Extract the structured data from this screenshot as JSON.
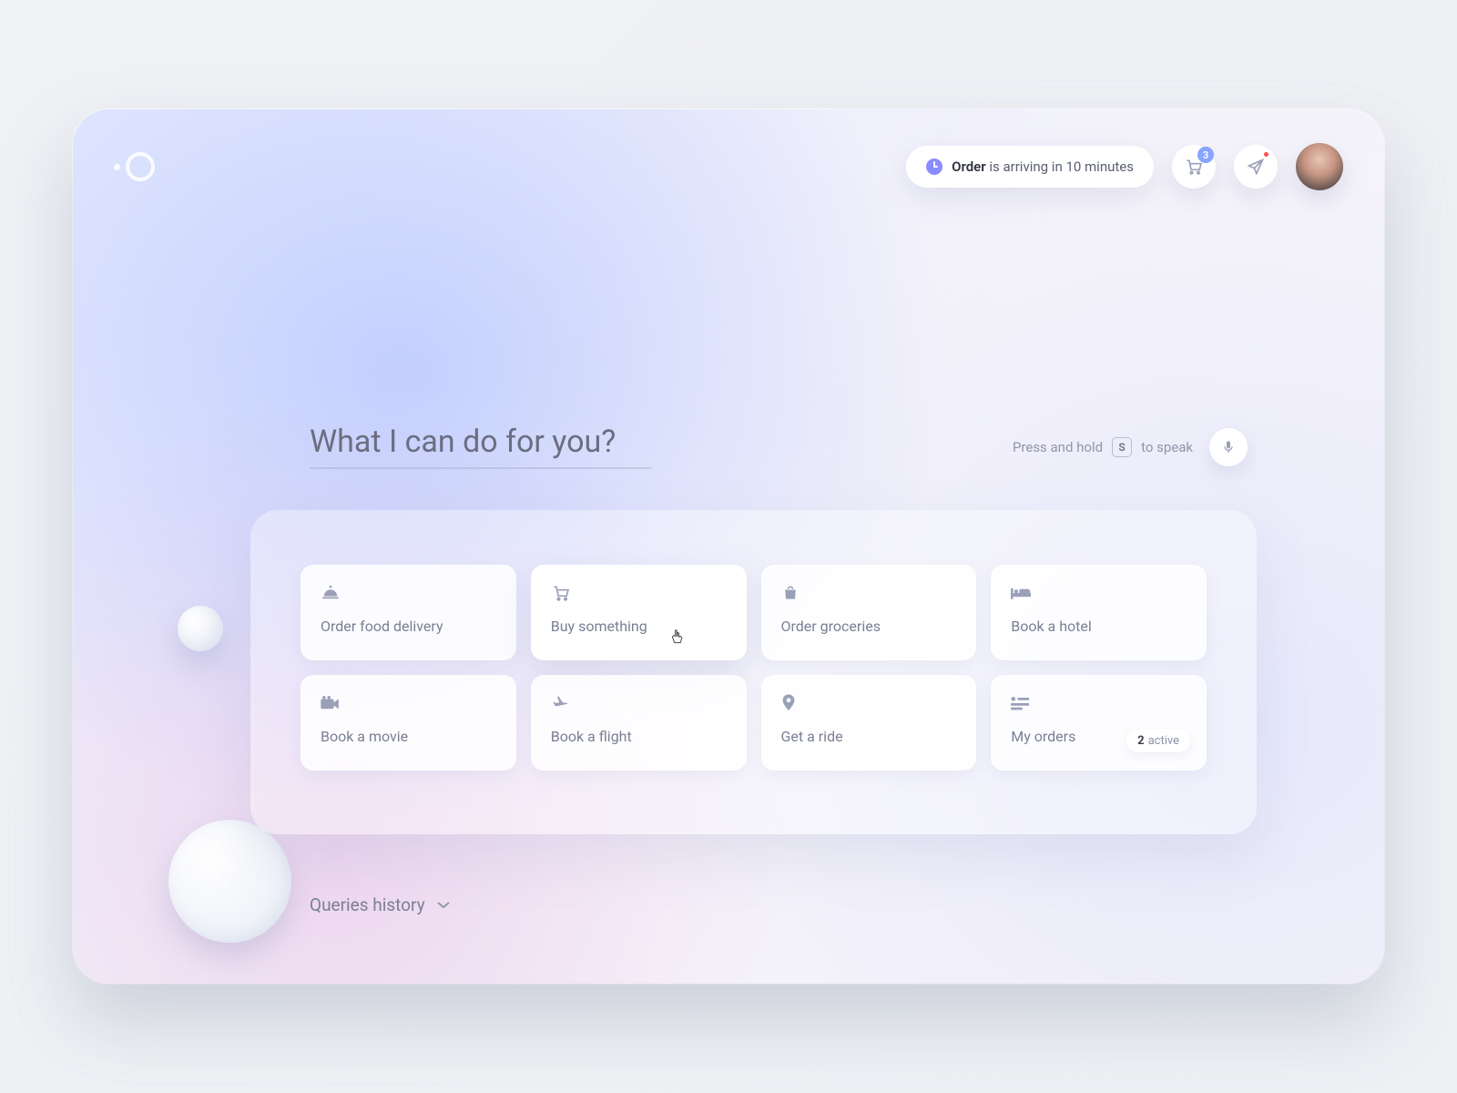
{
  "header": {
    "notice_prefix_bold": "Order",
    "notice_rest": " is arriving in 10 minutes",
    "cart_badge": "3"
  },
  "prompt": {
    "heading": "What I can do for you?",
    "speak_prefix": "Press and hold",
    "speak_key": "S",
    "speak_suffix": "to speak"
  },
  "cards": [
    {
      "label": "Order food delivery",
      "icon": "cloche"
    },
    {
      "label": "Buy something",
      "icon": "cart"
    },
    {
      "label": "Order groceries",
      "icon": "bag"
    },
    {
      "label": "Book a hotel",
      "icon": "bed"
    },
    {
      "label": "Book a movie",
      "icon": "film"
    },
    {
      "label": "Book a flight",
      "icon": "plane"
    },
    {
      "label": "Get a ride",
      "icon": "pin"
    },
    {
      "label": "My orders",
      "icon": "list",
      "chip_num": "2",
      "chip_text": "active"
    }
  ],
  "history": {
    "label": "Queries history"
  }
}
